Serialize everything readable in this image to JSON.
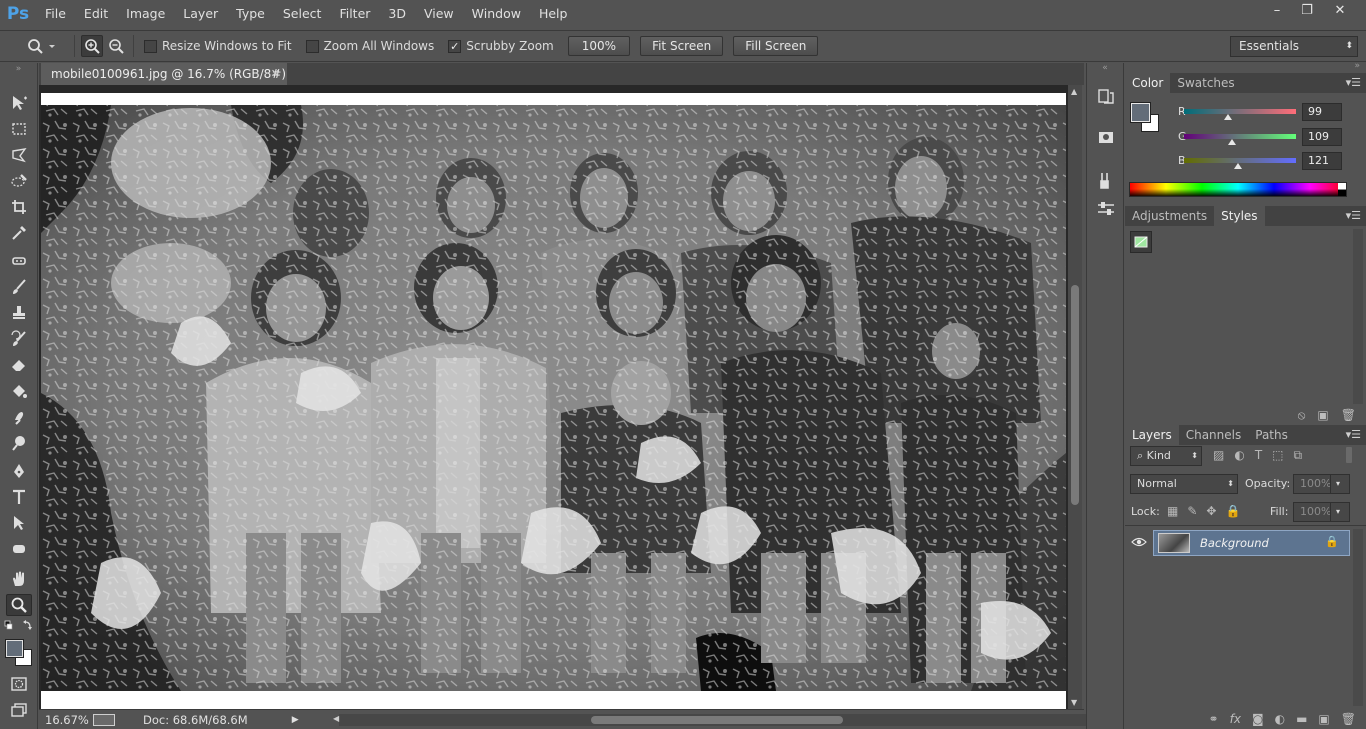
{
  "app": {
    "logo": "Ps"
  },
  "menu": [
    "File",
    "Edit",
    "Image",
    "Layer",
    "Type",
    "Select",
    "Filter",
    "3D",
    "View",
    "Window",
    "Help"
  ],
  "window_controls": {
    "minimize": "–",
    "restore": "❐",
    "close": "✕"
  },
  "options": {
    "resize_windows": {
      "label": "Resize Windows to Fit",
      "checked": false
    },
    "zoom_all": {
      "label": "Zoom All Windows",
      "checked": false
    },
    "scrubby": {
      "label": "Scrubby Zoom",
      "checked": true
    },
    "btn_100": "100%",
    "btn_fit": "Fit Screen",
    "btn_fill": "Fill Screen",
    "workspace": "Essentials"
  },
  "document": {
    "tab_title": "mobile0100961.jpg @ 16.7% (RGB/8#)",
    "close": "✕"
  },
  "status": {
    "zoom": "16.67%",
    "doc": "Doc: 68.6M/68.6M"
  },
  "panels": {
    "color_tabs": [
      "Color",
      "Swatches"
    ],
    "color": {
      "r_label": "R",
      "r": "99",
      "g_label": "G",
      "g": "109",
      "b_label": "B",
      "b": "121",
      "foreground": "#636d79"
    },
    "adjust_tabs": [
      "Adjustments",
      "Styles"
    ],
    "layers_tabs": [
      "Layers",
      "Channels",
      "Paths"
    ],
    "layers": {
      "kind": "Kind",
      "blend_mode": "Normal",
      "opacity_label": "Opacity:",
      "opacity": "100%",
      "lock_label": "Lock:",
      "fill_label": "Fill:",
      "fill": "100%",
      "layer_name": "Background"
    }
  }
}
